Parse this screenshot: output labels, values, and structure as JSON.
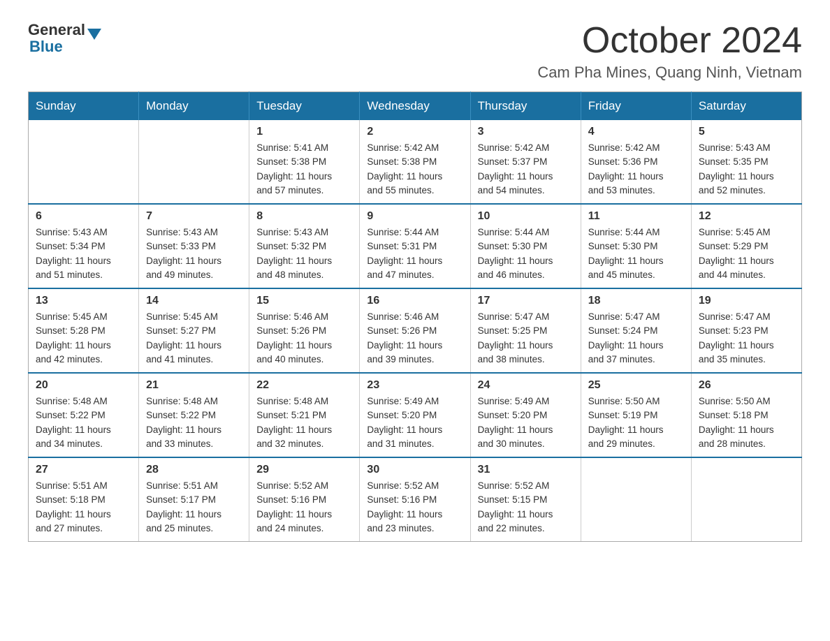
{
  "logo": {
    "general": "General",
    "blue": "Blue"
  },
  "header": {
    "month": "October 2024",
    "location": "Cam Pha Mines, Quang Ninh, Vietnam"
  },
  "weekdays": [
    "Sunday",
    "Monday",
    "Tuesday",
    "Wednesday",
    "Thursday",
    "Friday",
    "Saturday"
  ],
  "weeks": [
    [
      {
        "day": "",
        "info": ""
      },
      {
        "day": "",
        "info": ""
      },
      {
        "day": "1",
        "info": "Sunrise: 5:41 AM\nSunset: 5:38 PM\nDaylight: 11 hours\nand 57 minutes."
      },
      {
        "day": "2",
        "info": "Sunrise: 5:42 AM\nSunset: 5:38 PM\nDaylight: 11 hours\nand 55 minutes."
      },
      {
        "day": "3",
        "info": "Sunrise: 5:42 AM\nSunset: 5:37 PM\nDaylight: 11 hours\nand 54 minutes."
      },
      {
        "day": "4",
        "info": "Sunrise: 5:42 AM\nSunset: 5:36 PM\nDaylight: 11 hours\nand 53 minutes."
      },
      {
        "day": "5",
        "info": "Sunrise: 5:43 AM\nSunset: 5:35 PM\nDaylight: 11 hours\nand 52 minutes."
      }
    ],
    [
      {
        "day": "6",
        "info": "Sunrise: 5:43 AM\nSunset: 5:34 PM\nDaylight: 11 hours\nand 51 minutes."
      },
      {
        "day": "7",
        "info": "Sunrise: 5:43 AM\nSunset: 5:33 PM\nDaylight: 11 hours\nand 49 minutes."
      },
      {
        "day": "8",
        "info": "Sunrise: 5:43 AM\nSunset: 5:32 PM\nDaylight: 11 hours\nand 48 minutes."
      },
      {
        "day": "9",
        "info": "Sunrise: 5:44 AM\nSunset: 5:31 PM\nDaylight: 11 hours\nand 47 minutes."
      },
      {
        "day": "10",
        "info": "Sunrise: 5:44 AM\nSunset: 5:30 PM\nDaylight: 11 hours\nand 46 minutes."
      },
      {
        "day": "11",
        "info": "Sunrise: 5:44 AM\nSunset: 5:30 PM\nDaylight: 11 hours\nand 45 minutes."
      },
      {
        "day": "12",
        "info": "Sunrise: 5:45 AM\nSunset: 5:29 PM\nDaylight: 11 hours\nand 44 minutes."
      }
    ],
    [
      {
        "day": "13",
        "info": "Sunrise: 5:45 AM\nSunset: 5:28 PM\nDaylight: 11 hours\nand 42 minutes."
      },
      {
        "day": "14",
        "info": "Sunrise: 5:45 AM\nSunset: 5:27 PM\nDaylight: 11 hours\nand 41 minutes."
      },
      {
        "day": "15",
        "info": "Sunrise: 5:46 AM\nSunset: 5:26 PM\nDaylight: 11 hours\nand 40 minutes."
      },
      {
        "day": "16",
        "info": "Sunrise: 5:46 AM\nSunset: 5:26 PM\nDaylight: 11 hours\nand 39 minutes."
      },
      {
        "day": "17",
        "info": "Sunrise: 5:47 AM\nSunset: 5:25 PM\nDaylight: 11 hours\nand 38 minutes."
      },
      {
        "day": "18",
        "info": "Sunrise: 5:47 AM\nSunset: 5:24 PM\nDaylight: 11 hours\nand 37 minutes."
      },
      {
        "day": "19",
        "info": "Sunrise: 5:47 AM\nSunset: 5:23 PM\nDaylight: 11 hours\nand 35 minutes."
      }
    ],
    [
      {
        "day": "20",
        "info": "Sunrise: 5:48 AM\nSunset: 5:22 PM\nDaylight: 11 hours\nand 34 minutes."
      },
      {
        "day": "21",
        "info": "Sunrise: 5:48 AM\nSunset: 5:22 PM\nDaylight: 11 hours\nand 33 minutes."
      },
      {
        "day": "22",
        "info": "Sunrise: 5:48 AM\nSunset: 5:21 PM\nDaylight: 11 hours\nand 32 minutes."
      },
      {
        "day": "23",
        "info": "Sunrise: 5:49 AM\nSunset: 5:20 PM\nDaylight: 11 hours\nand 31 minutes."
      },
      {
        "day": "24",
        "info": "Sunrise: 5:49 AM\nSunset: 5:20 PM\nDaylight: 11 hours\nand 30 minutes."
      },
      {
        "day": "25",
        "info": "Sunrise: 5:50 AM\nSunset: 5:19 PM\nDaylight: 11 hours\nand 29 minutes."
      },
      {
        "day": "26",
        "info": "Sunrise: 5:50 AM\nSunset: 5:18 PM\nDaylight: 11 hours\nand 28 minutes."
      }
    ],
    [
      {
        "day": "27",
        "info": "Sunrise: 5:51 AM\nSunset: 5:18 PM\nDaylight: 11 hours\nand 27 minutes."
      },
      {
        "day": "28",
        "info": "Sunrise: 5:51 AM\nSunset: 5:17 PM\nDaylight: 11 hours\nand 25 minutes."
      },
      {
        "day": "29",
        "info": "Sunrise: 5:52 AM\nSunset: 5:16 PM\nDaylight: 11 hours\nand 24 minutes."
      },
      {
        "day": "30",
        "info": "Sunrise: 5:52 AM\nSunset: 5:16 PM\nDaylight: 11 hours\nand 23 minutes."
      },
      {
        "day": "31",
        "info": "Sunrise: 5:52 AM\nSunset: 5:15 PM\nDaylight: 11 hours\nand 22 minutes."
      },
      {
        "day": "",
        "info": ""
      },
      {
        "day": "",
        "info": ""
      }
    ]
  ]
}
